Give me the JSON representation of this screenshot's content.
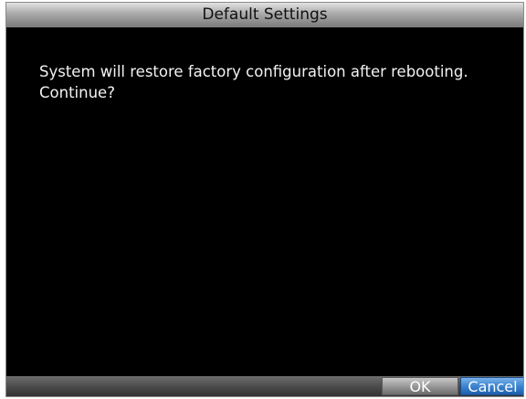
{
  "dialog": {
    "title": "Default Settings",
    "message": "System will restore factory configuration after rebooting.\nContinue?",
    "buttons": {
      "ok_label": "OK",
      "cancel_label": "Cancel"
    }
  },
  "colors": {
    "background": "#000000",
    "title_bar": "#a9a9a9",
    "ok_button": "#9a9a9a",
    "cancel_button": "#3b84d0",
    "message_text": "#f2f2f2"
  }
}
